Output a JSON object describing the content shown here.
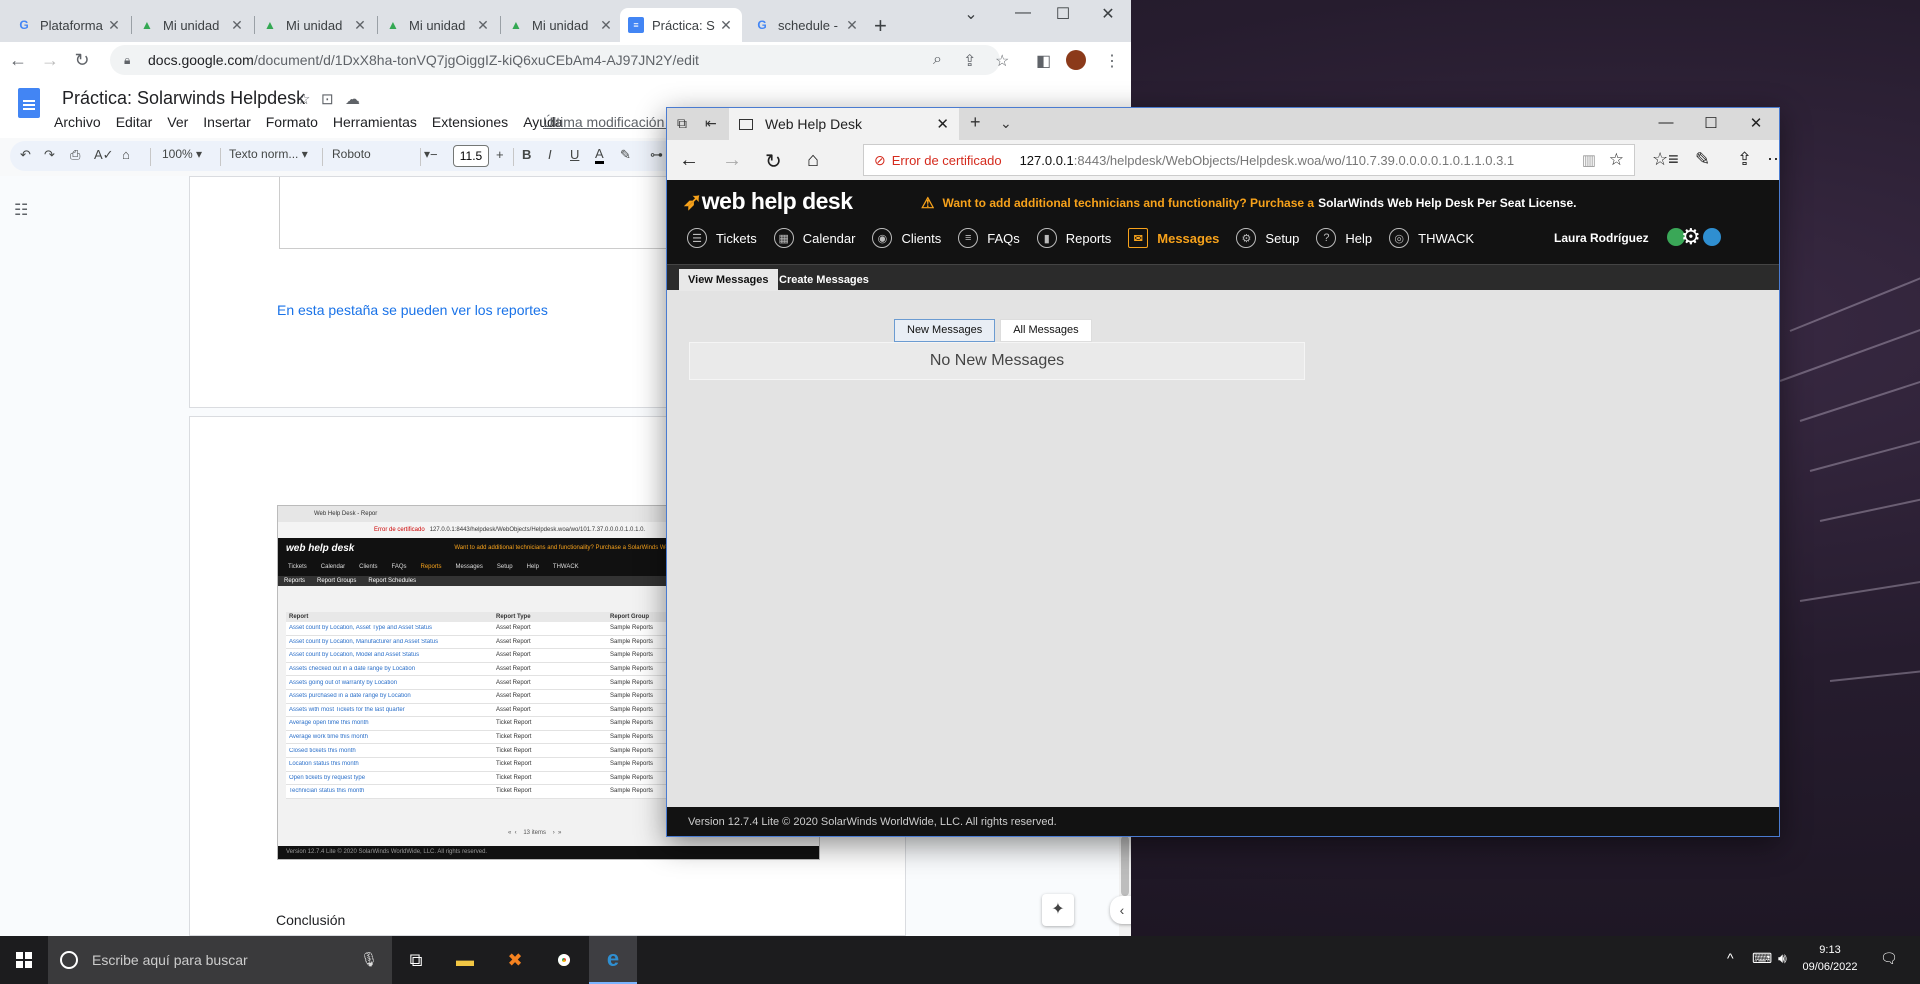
{
  "chrome": {
    "tabs": [
      {
        "label": "Plataforma",
        "icon": "google-icon"
      },
      {
        "label": "Mi unidad",
        "icon": "drive-icon"
      },
      {
        "label": "Mi unidad",
        "icon": "drive-icon"
      },
      {
        "label": "Mi unidad",
        "icon": "drive-icon"
      },
      {
        "label": "Mi unidad",
        "icon": "drive-icon"
      },
      {
        "label": "Práctica: S",
        "icon": "docs-icon"
      },
      {
        "label": "schedule -",
        "icon": "google-icon"
      }
    ],
    "url_host": "docs.google.com",
    "url_path": "/document/d/1DxX8ha-tonVQ7jgOiggIZ-kiQ6xuCEbAm4-AJ97JN2Y/edit"
  },
  "docs": {
    "title": "Práctica: Solarwinds Helpdesk",
    "menu": [
      "Archivo",
      "Editar",
      "Ver",
      "Insertar",
      "Formato",
      "Herramientas",
      "Extensiones",
      "Ayuda"
    ],
    "last_edit": "Última modificación h",
    "zoom": "100%",
    "style": "Texto norm...",
    "font": "Roboto",
    "font_size": "11.5",
    "link_text": "En esta pestaña se pueden ver los reportes",
    "conclusion": "Conclusión",
    "embedded": {
      "tab_title": "Web Help Desk - Repor",
      "cert": "Error de certificado",
      "url": "127.0.0.1:8443/helpdesk/WebObjects/Helpdesk.woa/wo/101.7.37.0.0.0.0.1.0.1.0.",
      "logo": "web help desk",
      "promo": "Want to add additional technicians and functionality? Purchase a SolarWinds Web Help Desk Per Se",
      "nav": [
        "Tickets",
        "Calendar",
        "Clients",
        "FAQs",
        "Reports",
        "Messages",
        "Setup",
        "Help",
        "THWACK"
      ],
      "subtabs": [
        "Reports",
        "Report Groups",
        "Report Schedules"
      ],
      "headers": [
        "Report",
        "Report Type",
        "Report Group"
      ],
      "rows": [
        [
          "Asset count by Location, Asset Type and Asset Status",
          "Asset Report",
          "Sample Reports"
        ],
        [
          "Asset count by Location, Manufacturer and Asset Status",
          "Asset Report",
          "Sample Reports"
        ],
        [
          "Asset count by Location, Model and Asset Status",
          "Asset Report",
          "Sample Reports"
        ],
        [
          "Assets checked out in a date range by Location",
          "Asset Report",
          "Sample Reports"
        ],
        [
          "Assets going out of warranty by Location",
          "Asset Report",
          "Sample Reports"
        ],
        [
          "Assets purchased in a date range by Location",
          "Asset Report",
          "Sample Reports"
        ],
        [
          "Assets with most Tickets for the last quarter",
          "Asset Report",
          "Sample Reports"
        ],
        [
          "Average open time this month",
          "Ticket Report",
          "Sample Reports"
        ],
        [
          "Average work time this month",
          "Ticket Report",
          "Sample Reports"
        ],
        [
          "Closed tickets this month",
          "Ticket Report",
          "Sample Reports"
        ],
        [
          "Location status this month",
          "Ticket Report",
          "Sample Reports"
        ],
        [
          "Open tickets by request type",
          "Ticket Report",
          "Sample Reports"
        ],
        [
          "Technician status this month",
          "Ticket Report",
          "Sample Reports"
        ]
      ],
      "pager": "13 items",
      "footer": "Version 12.7.4 Lite © 2020 SolarWinds WorldWide, LLC. All rights reserved."
    }
  },
  "edge": {
    "tab_title": "Web Help Desk",
    "cert_error": "Error de certificado",
    "url_host": "127.0.0.1",
    "url_path": ":8443/helpdesk/WebObjects/Helpdesk.woa/wo/110.7.39.0.0.0.0.1.0.1.1.0.3.1"
  },
  "whd": {
    "logo": "web help desk",
    "promo_orange": "Want to add additional technicians and functionality? Purchase a",
    "promo_white": "SolarWinds Web Help Desk Per Seat License.",
    "nav": [
      {
        "label": "Tickets",
        "icon": "tickets-icon",
        "glyph": "☰"
      },
      {
        "label": "Calendar",
        "icon": "calendar-icon",
        "glyph": "▦"
      },
      {
        "label": "Clients",
        "icon": "clients-icon",
        "glyph": "◉"
      },
      {
        "label": "FAQs",
        "icon": "faqs-icon",
        "glyph": "≡"
      },
      {
        "label": "Reports",
        "icon": "reports-icon",
        "glyph": "▮"
      },
      {
        "label": "Messages",
        "icon": "messages-icon",
        "glyph": "✉"
      },
      {
        "label": "Setup",
        "icon": "setup-icon",
        "glyph": "⚙"
      },
      {
        "label": "Help",
        "icon": "help-icon",
        "glyph": "?"
      },
      {
        "label": "THWACK",
        "icon": "thwack-icon",
        "glyph": "◎"
      }
    ],
    "active_nav": "Messages",
    "user": "Laura Rodríguez",
    "subtabs": [
      "View Messages",
      "Create Messages"
    ],
    "msg_tabs": [
      "New Messages",
      "All Messages"
    ],
    "empty_text": "No New Messages",
    "footer": "Version 12.7.4 Lite © 2020 SolarWinds WorldWide, LLC. All rights reserved.",
    "accent": "#f7a21b"
  },
  "taskbar": {
    "search_placeholder": "Escribe aquí para buscar",
    "time": "9:13",
    "date": "09/06/2022"
  }
}
